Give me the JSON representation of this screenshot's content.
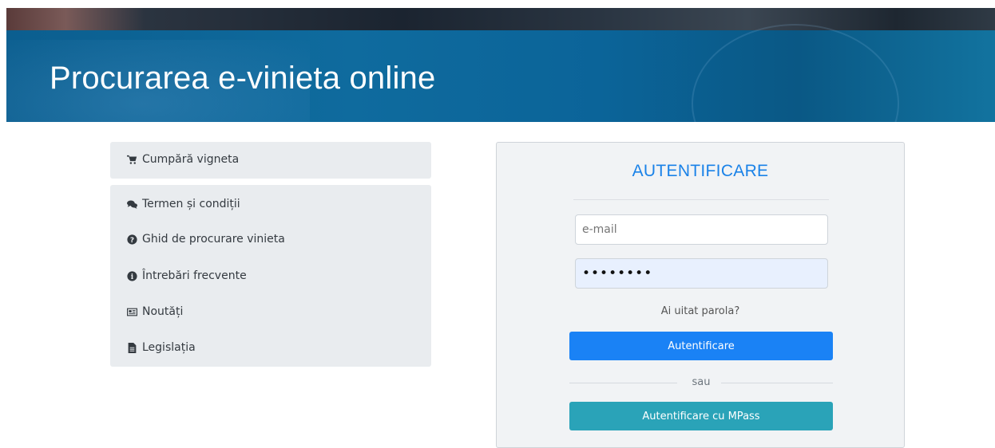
{
  "banner": {
    "title": "Procurarea e-vinieta online"
  },
  "menu": {
    "buy": {
      "label": "Cumpără vigneta",
      "icon": "cart-icon"
    },
    "items": [
      {
        "label": "Termen și condiții",
        "icon": "comments-icon"
      },
      {
        "label": "Ghid de procurare vinieta",
        "icon": "question-circle-icon"
      },
      {
        "label": "Întrebări frecvente",
        "icon": "info-circle-icon"
      },
      {
        "label": "Noutăți",
        "icon": "newspaper-icon"
      },
      {
        "label": "Legislația",
        "icon": "file-icon"
      }
    ]
  },
  "login": {
    "title": "AUTENTIFICARE",
    "email_placeholder": "e-mail",
    "password_value": "••••••••",
    "forgot_label": "Ai uitat parola?",
    "submit_label": "Autentificare",
    "separator_label": "sau",
    "mpass_label": "Autentificare cu MPass"
  },
  "colors": {
    "accent": "#1a82f5",
    "title": "#1a82e8",
    "mpass": "#2aa3b8",
    "menu_bg": "#e9ecef",
    "banner": "#0f6b9e"
  }
}
